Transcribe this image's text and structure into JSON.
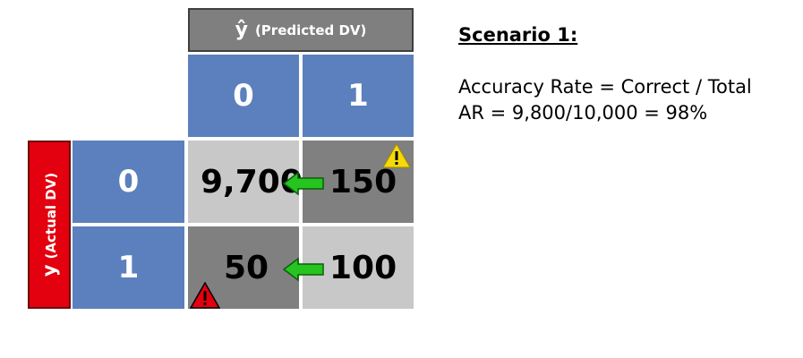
{
  "colors": {
    "header_gray": "#7f7f7f",
    "axis_red": "#e3000f",
    "label_blue": "#5b80bd",
    "cell_light": "#c8c8c8",
    "cell_dark": "#808080",
    "arrow_green": "#26c41e",
    "warn_yellow": "#f5d90a",
    "warn_red": "#e3000f"
  },
  "predicted_header": {
    "symbol": "ŷ",
    "label": "(Predicted DV)"
  },
  "actual_header": {
    "symbol": "y",
    "label": "(Actual DV)"
  },
  "predicted_labels": [
    "0",
    "1"
  ],
  "actual_labels": [
    "0",
    "1"
  ],
  "cells": [
    [
      "9,700",
      "150"
    ],
    [
      "50",
      "100"
    ]
  ],
  "icons": {
    "arrow": "left-arrow-icon",
    "warning_yellow": "warning-triangle-icon",
    "warning_red": "danger-triangle-icon"
  },
  "scenario": {
    "title": "Scenario 1:",
    "line1": "Accuracy Rate = Correct / Total",
    "line2": "AR = 9,800/10,000 = 98%"
  }
}
